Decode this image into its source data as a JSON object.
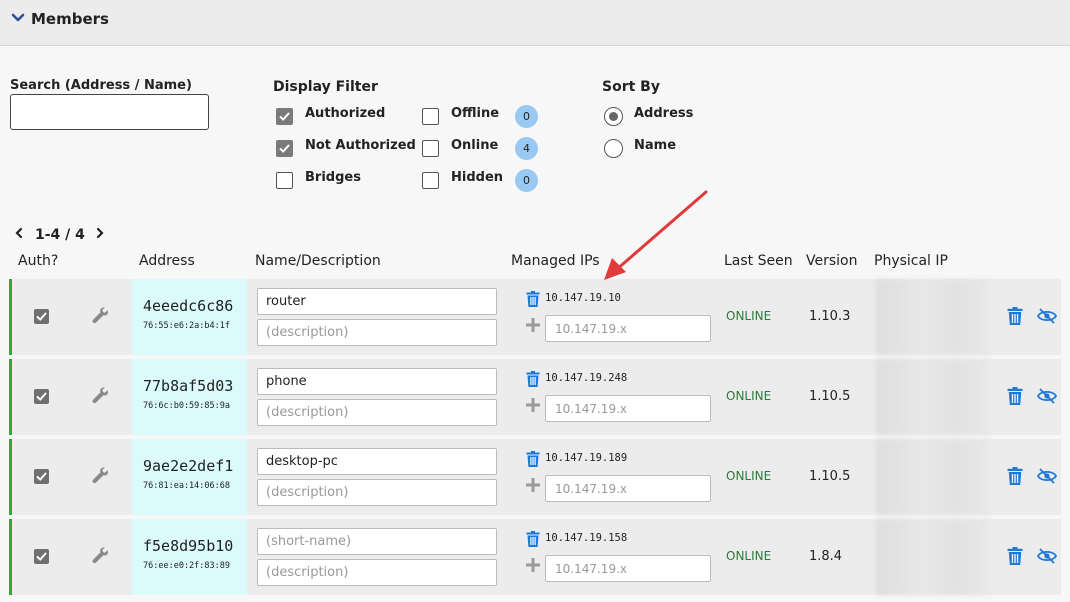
{
  "section": {
    "title": "Members"
  },
  "search": {
    "label": "Search (Address / Name)",
    "value": "",
    "placeholder": ""
  },
  "display_filter": {
    "title": "Display Filter",
    "options": [
      {
        "label": "Authorized",
        "checked": true
      },
      {
        "label": "Not Authorized",
        "checked": true
      },
      {
        "label": "Bridges",
        "checked": false
      },
      {
        "label": "Offline",
        "checked": false,
        "count": "0"
      },
      {
        "label": "Online",
        "checked": false,
        "count": "4"
      },
      {
        "label": "Hidden",
        "checked": false,
        "count": "0"
      }
    ]
  },
  "sort_by": {
    "title": "Sort By",
    "options": [
      {
        "label": "Address",
        "selected": true
      },
      {
        "label": "Name",
        "selected": false
      }
    ]
  },
  "pagination": {
    "range": "1-4 / 4"
  },
  "columns": {
    "auth": "Auth?",
    "address": "Address",
    "name": "Name/Description",
    "managed_ips": "Managed IPs",
    "last_seen": "Last Seen",
    "version": "Version",
    "physical_ip": "Physical IP"
  },
  "placeholders": {
    "short_name": "(short-name)",
    "description": "(description)",
    "ip": "10.147.19.x"
  },
  "members": [
    {
      "address": "4eeedc6c86",
      "mac": "76:55:e6:2a:b4:1f",
      "name": "router",
      "managed_ip": "10.147.19.10",
      "last_seen": "ONLINE",
      "version": "1.10.3"
    },
    {
      "address": "77b8af5d03",
      "mac": "76:6c:b0:59:85:9a",
      "name": "phone",
      "managed_ip": "10.147.19.248",
      "last_seen": "ONLINE",
      "version": "1.10.5"
    },
    {
      "address": "9ae2e2def1",
      "mac": "76:81:ea:14:06:68",
      "name": "desktop-pc",
      "managed_ip": "10.147.19.189",
      "last_seen": "ONLINE",
      "version": "1.10.5"
    },
    {
      "address": "f5e8d95b10",
      "mac": "76:ee:e0:2f:83:89",
      "name": "",
      "managed_ip": "10.147.19.158",
      "last_seen": "ONLINE",
      "version": "1.8.4"
    }
  ],
  "colors": {
    "online_border": "#2eaa3c",
    "address_bg": "#dbfafb",
    "action_blue": "#1e78d6",
    "count_badge": "#98c9f2",
    "annotation_arrow": "#e03a3a"
  }
}
